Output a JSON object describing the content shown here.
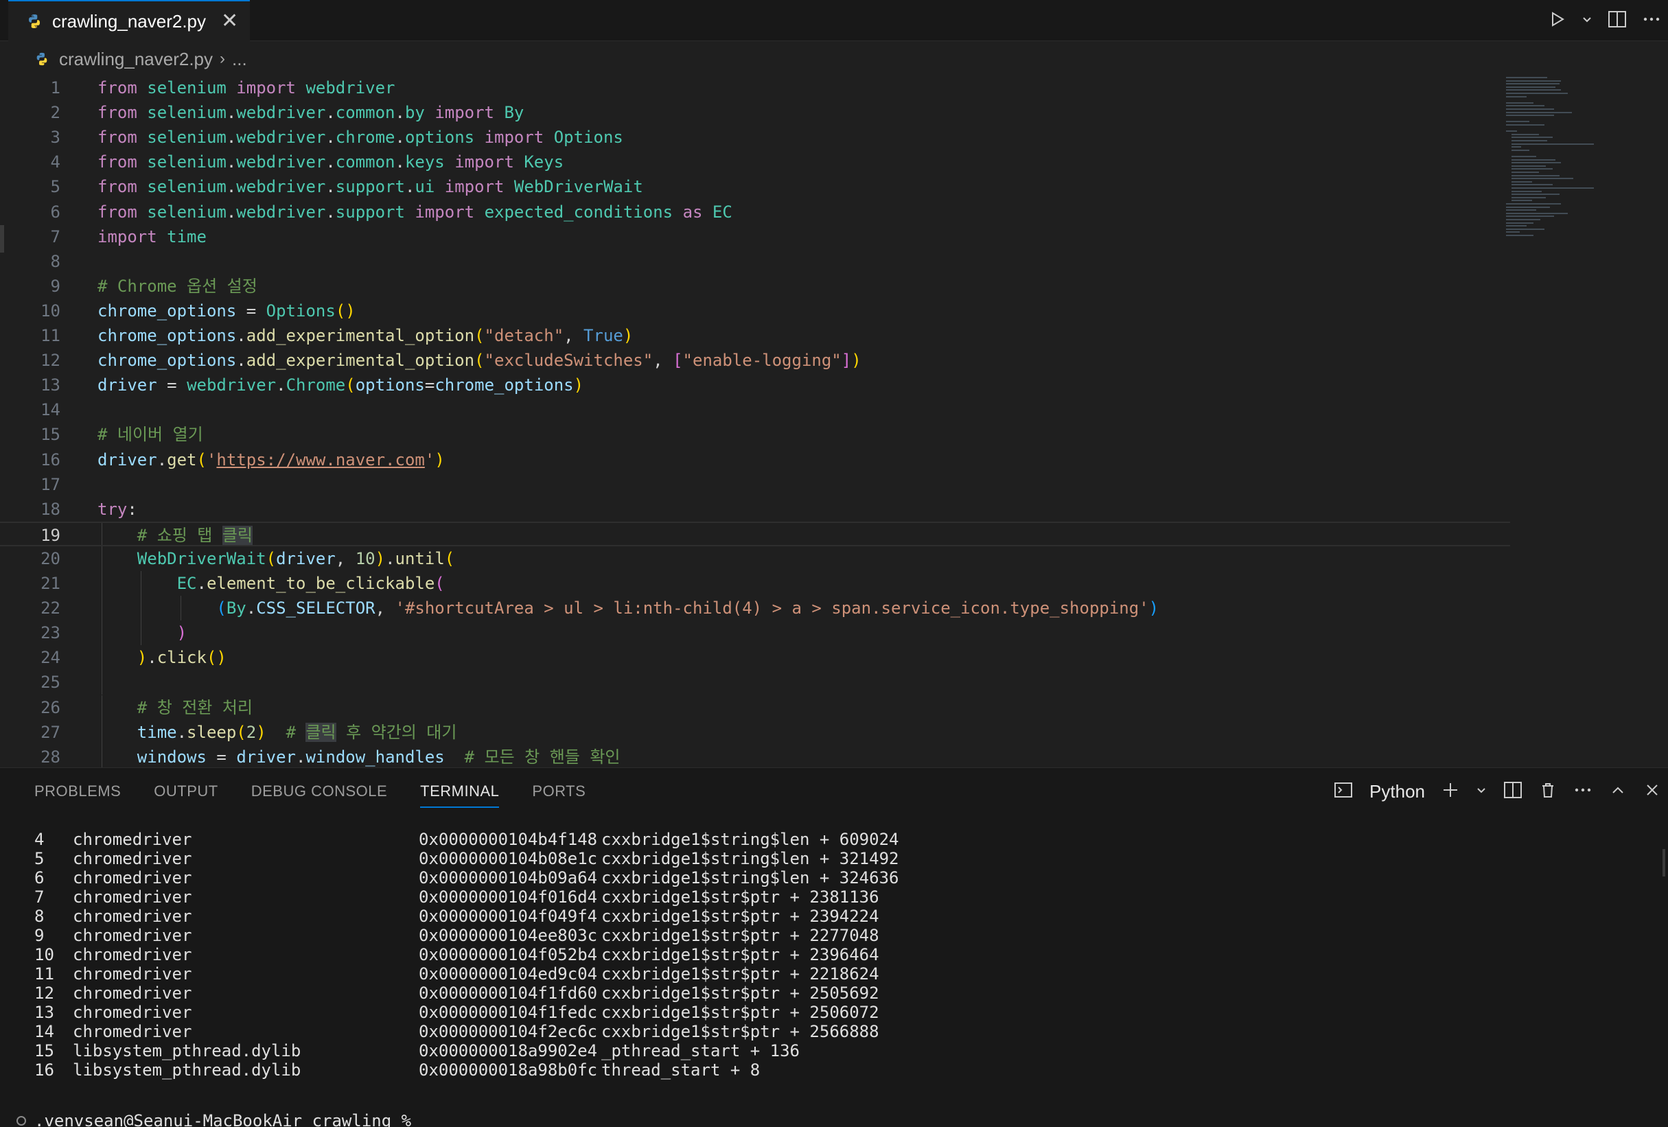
{
  "tab": {
    "filename": "crawling_naver2.py",
    "close_glyph": "✕"
  },
  "breadcrumb": {
    "file": "crawling_naver2.py",
    "separator": "›",
    "more": "..."
  },
  "editor": {
    "lines": [
      {
        "n": "1",
        "tokens": [
          [
            "kw",
            "from"
          ],
          [
            "txt",
            " "
          ],
          [
            "mod",
            "selenium"
          ],
          [
            "txt",
            " "
          ],
          [
            "kw",
            "import"
          ],
          [
            "txt",
            " "
          ],
          [
            "mod",
            "webdriver"
          ]
        ]
      },
      {
        "n": "2",
        "tokens": [
          [
            "kw",
            "from"
          ],
          [
            "txt",
            " "
          ],
          [
            "mod",
            "selenium"
          ],
          [
            "txt",
            "."
          ],
          [
            "mod",
            "webdriver"
          ],
          [
            "txt",
            "."
          ],
          [
            "mod",
            "common"
          ],
          [
            "txt",
            "."
          ],
          [
            "mod",
            "by"
          ],
          [
            "txt",
            " "
          ],
          [
            "kw",
            "import"
          ],
          [
            "txt",
            " "
          ],
          [
            "mod",
            "By"
          ]
        ]
      },
      {
        "n": "3",
        "tokens": [
          [
            "kw",
            "from"
          ],
          [
            "txt",
            " "
          ],
          [
            "mod",
            "selenium"
          ],
          [
            "txt",
            "."
          ],
          [
            "mod",
            "webdriver"
          ],
          [
            "txt",
            "."
          ],
          [
            "mod",
            "chrome"
          ],
          [
            "txt",
            "."
          ],
          [
            "mod",
            "options"
          ],
          [
            "txt",
            " "
          ],
          [
            "kw",
            "import"
          ],
          [
            "txt",
            " "
          ],
          [
            "mod",
            "Options"
          ]
        ]
      },
      {
        "n": "4",
        "tokens": [
          [
            "kw",
            "from"
          ],
          [
            "txt",
            " "
          ],
          [
            "mod",
            "selenium"
          ],
          [
            "txt",
            "."
          ],
          [
            "mod",
            "webdriver"
          ],
          [
            "txt",
            "."
          ],
          [
            "mod",
            "common"
          ],
          [
            "txt",
            "."
          ],
          [
            "mod",
            "keys"
          ],
          [
            "txt",
            " "
          ],
          [
            "kw",
            "import"
          ],
          [
            "txt",
            " "
          ],
          [
            "mod",
            "Keys"
          ]
        ]
      },
      {
        "n": "5",
        "tokens": [
          [
            "kw",
            "from"
          ],
          [
            "txt",
            " "
          ],
          [
            "mod",
            "selenium"
          ],
          [
            "txt",
            "."
          ],
          [
            "mod",
            "webdriver"
          ],
          [
            "txt",
            "."
          ],
          [
            "mod",
            "support"
          ],
          [
            "txt",
            "."
          ],
          [
            "mod",
            "ui"
          ],
          [
            "txt",
            " "
          ],
          [
            "kw",
            "import"
          ],
          [
            "txt",
            " "
          ],
          [
            "mod",
            "WebDriverWait"
          ]
        ]
      },
      {
        "n": "6",
        "tokens": [
          [
            "kw",
            "from"
          ],
          [
            "txt",
            " "
          ],
          [
            "mod",
            "selenium"
          ],
          [
            "txt",
            "."
          ],
          [
            "mod",
            "webdriver"
          ],
          [
            "txt",
            "."
          ],
          [
            "mod",
            "support"
          ],
          [
            "txt",
            " "
          ],
          [
            "kw",
            "import"
          ],
          [
            "txt",
            " "
          ],
          [
            "mod",
            "expected_conditions"
          ],
          [
            "txt",
            " "
          ],
          [
            "kw",
            "as"
          ],
          [
            "txt",
            " "
          ],
          [
            "mod",
            "EC"
          ]
        ]
      },
      {
        "n": "7",
        "tokens": [
          [
            "kw",
            "import"
          ],
          [
            "txt",
            " "
          ],
          [
            "mod",
            "time"
          ]
        ]
      },
      {
        "n": "8",
        "tokens": []
      },
      {
        "n": "9",
        "tokens": [
          [
            "com",
            "# Chrome 옵션 설정"
          ]
        ]
      },
      {
        "n": "10",
        "tokens": [
          [
            "var",
            "chrome_options"
          ],
          [
            "txt",
            " = "
          ],
          [
            "mod",
            "Options"
          ],
          [
            "p1",
            "()"
          ]
        ]
      },
      {
        "n": "11",
        "tokens": [
          [
            "var",
            "chrome_options"
          ],
          [
            "txt",
            "."
          ],
          [
            "fn",
            "add_experimental_option"
          ],
          [
            "p1",
            "("
          ],
          [
            "str",
            "\"detach\""
          ],
          [
            "txt",
            ", "
          ],
          [
            "bool",
            "True"
          ],
          [
            "p1",
            ")"
          ]
        ]
      },
      {
        "n": "12",
        "tokens": [
          [
            "var",
            "chrome_options"
          ],
          [
            "txt",
            "."
          ],
          [
            "fn",
            "add_experimental_option"
          ],
          [
            "p1",
            "("
          ],
          [
            "str",
            "\"excludeSwitches\""
          ],
          [
            "txt",
            ", "
          ],
          [
            "p2",
            "["
          ],
          [
            "str",
            "\"enable-logging\""
          ],
          [
            "p2",
            "]"
          ],
          [
            "p1",
            ")"
          ]
        ]
      },
      {
        "n": "13",
        "tokens": [
          [
            "var",
            "driver"
          ],
          [
            "txt",
            " = "
          ],
          [
            "mod",
            "webdriver"
          ],
          [
            "txt",
            "."
          ],
          [
            "mod",
            "Chrome"
          ],
          [
            "p1",
            "("
          ],
          [
            "var",
            "options"
          ],
          [
            "txt",
            "="
          ],
          [
            "var",
            "chrome_options"
          ],
          [
            "p1",
            ")"
          ]
        ]
      },
      {
        "n": "14",
        "tokens": []
      },
      {
        "n": "15",
        "tokens": [
          [
            "com",
            "# 네이버 열기"
          ]
        ]
      },
      {
        "n": "16",
        "tokens": [
          [
            "var",
            "driver"
          ],
          [
            "txt",
            "."
          ],
          [
            "fn",
            "get"
          ],
          [
            "p1",
            "("
          ],
          [
            "str",
            "'"
          ],
          [
            "url",
            "https://www.naver.com"
          ],
          [
            "str",
            "'"
          ],
          [
            "p1",
            ")"
          ]
        ]
      },
      {
        "n": "17",
        "tokens": []
      },
      {
        "n": "18",
        "tokens": [
          [
            "kw",
            "try"
          ],
          [
            "txt",
            ":"
          ]
        ]
      },
      {
        "n": "19",
        "tokens": [
          [
            "txt",
            "    "
          ],
          [
            "com",
            "# 쇼핑 탭 "
          ],
          [
            "comhl",
            "클릭"
          ]
        ]
      },
      {
        "n": "20",
        "tokens": [
          [
            "txt",
            "    "
          ],
          [
            "mod",
            "WebDriverWait"
          ],
          [
            "p1",
            "("
          ],
          [
            "var",
            "driver"
          ],
          [
            "txt",
            ", "
          ],
          [
            "num",
            "10"
          ],
          [
            "p1",
            ")"
          ],
          [
            "txt",
            "."
          ],
          [
            "fn",
            "until"
          ],
          [
            "p1",
            "("
          ]
        ]
      },
      {
        "n": "21",
        "tokens": [
          [
            "txt",
            "        "
          ],
          [
            "mod",
            "EC"
          ],
          [
            "txt",
            "."
          ],
          [
            "fn",
            "element_to_be_clickable"
          ],
          [
            "p2",
            "("
          ]
        ]
      },
      {
        "n": "22",
        "tokens": [
          [
            "txt",
            "            "
          ],
          [
            "p3",
            "("
          ],
          [
            "mod",
            "By"
          ],
          [
            "txt",
            "."
          ],
          [
            "var",
            "CSS_SELECTOR"
          ],
          [
            "txt",
            ", "
          ],
          [
            "str",
            "'#shortcutArea > ul > li:nth-child(4) > a > span.service_icon.type_shopping'"
          ],
          [
            "p3",
            ")"
          ]
        ]
      },
      {
        "n": "23",
        "tokens": [
          [
            "txt",
            "        "
          ],
          [
            "p2",
            ")"
          ]
        ]
      },
      {
        "n": "24",
        "tokens": [
          [
            "txt",
            "    "
          ],
          [
            "p1",
            ")"
          ],
          [
            "txt",
            "."
          ],
          [
            "fn",
            "click"
          ],
          [
            "p1",
            "()"
          ]
        ]
      },
      {
        "n": "25",
        "tokens": []
      },
      {
        "n": "26",
        "tokens": [
          [
            "txt",
            "    "
          ],
          [
            "com",
            "# 창 전환 처리"
          ]
        ]
      },
      {
        "n": "27",
        "tokens": [
          [
            "txt",
            "    "
          ],
          [
            "var",
            "time"
          ],
          [
            "txt",
            "."
          ],
          [
            "fn",
            "sleep"
          ],
          [
            "p1",
            "("
          ],
          [
            "num",
            "2"
          ],
          [
            "p1",
            ")"
          ],
          [
            "txt",
            "  "
          ],
          [
            "com",
            "# "
          ],
          [
            "comhl",
            "클릭"
          ],
          [
            "com",
            " 후 약간의 대기"
          ]
        ]
      },
      {
        "n": "28",
        "tokens": [
          [
            "txt",
            "    "
          ],
          [
            "var",
            "windows"
          ],
          [
            "txt",
            " = "
          ],
          [
            "var",
            "driver"
          ],
          [
            "txt",
            "."
          ],
          [
            "var",
            "window_handles"
          ],
          [
            "txt",
            "  "
          ],
          [
            "com",
            "# 모든 창 핸들 확인"
          ]
        ]
      }
    ],
    "active_line": "19"
  },
  "panel": {
    "tabs": [
      "PROBLEMS",
      "OUTPUT",
      "DEBUG CONSOLE",
      "TERMINAL",
      "PORTS"
    ],
    "active_tab": "TERMINAL",
    "terminal_profile": "Python"
  },
  "terminal": {
    "rows": [
      {
        "idx": "4",
        "module": "chromedriver",
        "addr": "0x0000000104b4f148",
        "sym": "cxxbridge1$string$len + 609024"
      },
      {
        "idx": "5",
        "module": "chromedriver",
        "addr": "0x0000000104b08e1c",
        "sym": "cxxbridge1$string$len + 321492"
      },
      {
        "idx": "6",
        "module": "chromedriver",
        "addr": "0x0000000104b09a64",
        "sym": "cxxbridge1$string$len + 324636"
      },
      {
        "idx": "7",
        "module": "chromedriver",
        "addr": "0x0000000104f016d4",
        "sym": "cxxbridge1$str$ptr + 2381136"
      },
      {
        "idx": "8",
        "module": "chromedriver",
        "addr": "0x0000000104f049f4",
        "sym": "cxxbridge1$str$ptr + 2394224"
      },
      {
        "idx": "9",
        "module": "chromedriver",
        "addr": "0x0000000104ee803c",
        "sym": "cxxbridge1$str$ptr + 2277048"
      },
      {
        "idx": "10",
        "module": "chromedriver",
        "addr": "0x0000000104f052b4",
        "sym": "cxxbridge1$str$ptr + 2396464"
      },
      {
        "idx": "11",
        "module": "chromedriver",
        "addr": "0x0000000104ed9c04",
        "sym": "cxxbridge1$str$ptr + 2218624"
      },
      {
        "idx": "12",
        "module": "chromedriver",
        "addr": "0x0000000104f1fd60",
        "sym": "cxxbridge1$str$ptr + 2505692"
      },
      {
        "idx": "13",
        "module": "chromedriver",
        "addr": "0x0000000104f1fedc",
        "sym": "cxxbridge1$str$ptr + 2506072"
      },
      {
        "idx": "14",
        "module": "chromedriver",
        "addr": "0x0000000104f2ec6c",
        "sym": "cxxbridge1$str$ptr + 2566888"
      },
      {
        "idx": "15",
        "module": "libsystem_pthread.dylib",
        "addr": "0x000000018a9902e4",
        "sym": "_pthread_start + 136"
      },
      {
        "idx": "16",
        "module": "libsystem_pthread.dylib",
        "addr": "0x000000018a98b0fc",
        "sym": "thread_start + 8"
      }
    ],
    "prompt": ".venvsean@Seanui-MacBookAir crawling %"
  },
  "icons": {
    "run": "run-icon",
    "split": "split-editor-icon",
    "more": "more-icon",
    "python": "python-icon",
    "terminal": "terminal-icon",
    "add": "add-icon",
    "trash": "trash-icon"
  },
  "colors": {
    "accent": "#0078d4",
    "editor_bg": "#1f1f1f",
    "panel_bg": "#181818"
  }
}
